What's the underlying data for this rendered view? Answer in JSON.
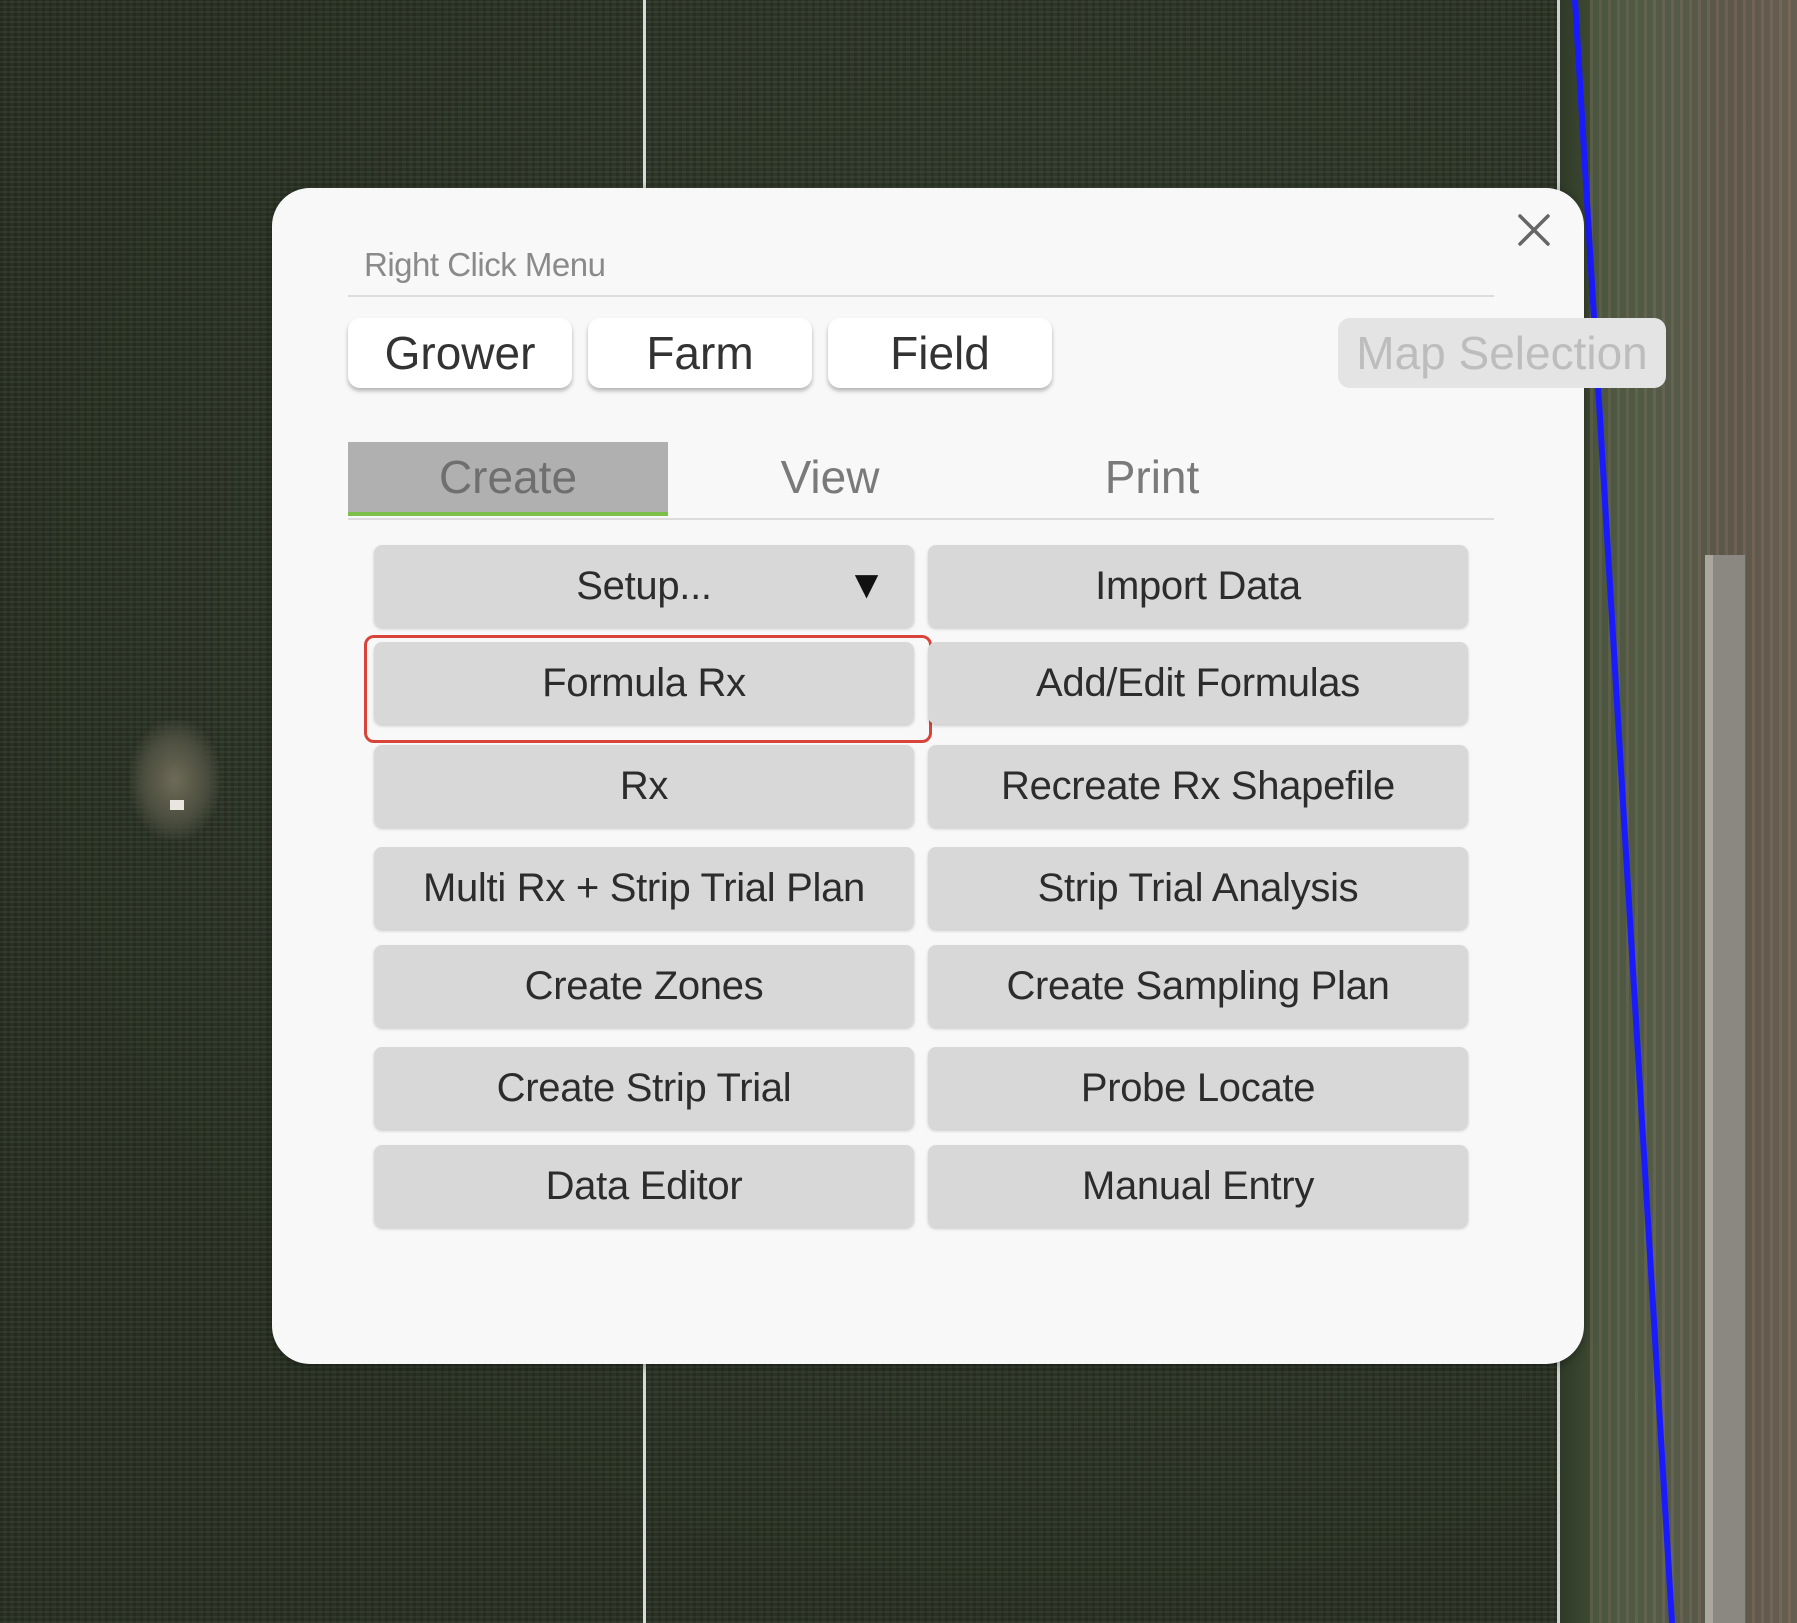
{
  "dialog": {
    "title": "Right Click Menu",
    "close_icon": "close-icon"
  },
  "level_tabs": [
    {
      "label": "Grower",
      "enabled": true
    },
    {
      "label": "Farm",
      "enabled": true
    },
    {
      "label": "Field",
      "enabled": true
    },
    {
      "label": "Map Selection",
      "enabled": false
    }
  ],
  "action_tabs": [
    {
      "label": "Create",
      "active": true
    },
    {
      "label": "View",
      "active": false
    },
    {
      "label": "Print",
      "active": false
    }
  ],
  "buttons": {
    "setup": "Setup...",
    "setup_caret": "▼",
    "import_data": "Import Data",
    "formula_rx": "Formula Rx",
    "add_edit_formulas": "Add/Edit Formulas",
    "rx": "Rx",
    "recreate_rx_shapefile": "Recreate Rx Shapefile",
    "multi_rx_strip_trial_plan": "Multi Rx + Strip Trial Plan",
    "strip_trial_analysis": "Strip Trial Analysis",
    "create_zones": "Create Zones",
    "create_sampling_plan": "Create Sampling Plan",
    "create_strip_trial": "Create Strip Trial",
    "probe_locate": "Probe Locate",
    "data_editor": "Data Editor",
    "manual_entry": "Manual Entry"
  },
  "highlighted_button": "Formula Rx",
  "colors": {
    "active_tab_underline": "#7cc04a",
    "highlight_border": "#d9443a",
    "field_boundary": "#1a1aff",
    "dialog_background": "#f8f8f8"
  }
}
